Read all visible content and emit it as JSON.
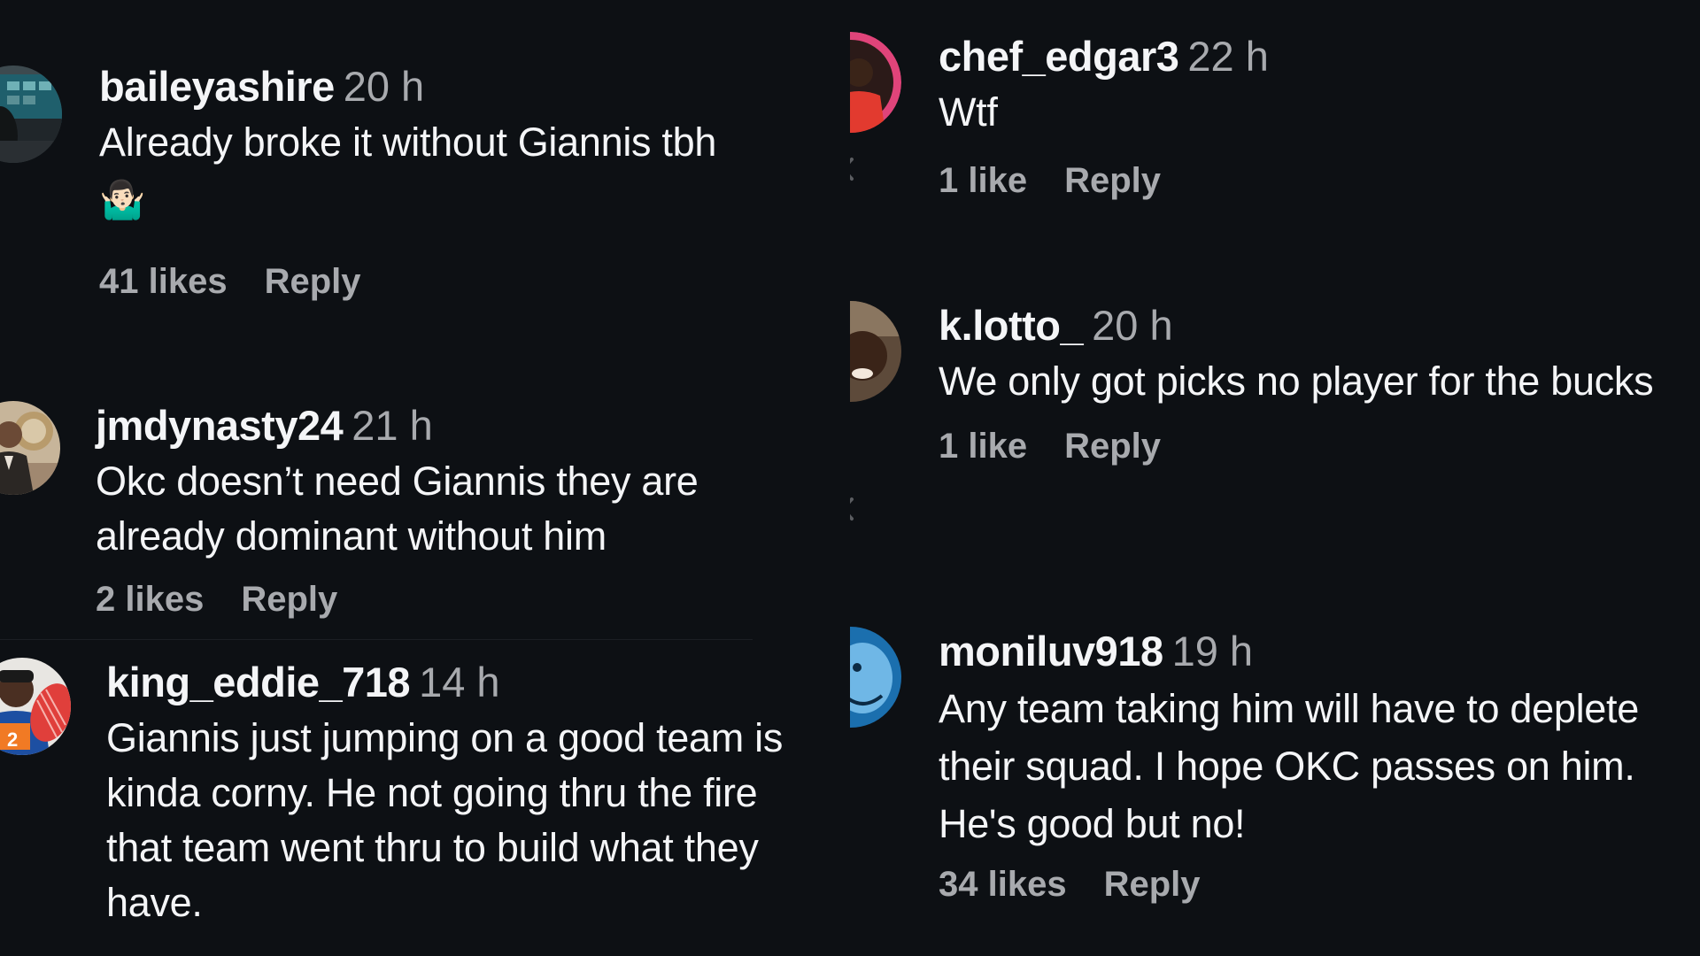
{
  "left_column": {
    "comments": [
      {
        "username": "baileyashire",
        "time": "20 h",
        "text": "Already broke it without Giannis tbh",
        "emoji": "🤷🏻‍♂️",
        "likes": "41 likes",
        "reply_label": "Reply"
      },
      {
        "username": "jmdynasty24",
        "time": "21 h",
        "text": "Okc doesn’t need Giannis they are already dominant without him",
        "likes": "2 likes",
        "reply_label": "Reply"
      },
      {
        "username": "king_eddie_718",
        "time": "14 h",
        "text": "Giannis just jumping on a good team is kinda corny. He not going thru the fire that team went thru to build what they have."
      }
    ]
  },
  "right_column": {
    "comments": [
      {
        "username": "chef_edgar3",
        "time": "22 h",
        "text": "Wtf",
        "likes": "1 like",
        "reply_label": "Reply"
      },
      {
        "username": "k.lotto_",
        "time": "20 h",
        "text": "We only got picks no player for the bucks",
        "likes": "1 like",
        "reply_label": "Reply"
      },
      {
        "username": "moniluv918",
        "time": "19 h",
        "text": "Any team taking him will have to deplete their squad. I hope OKC passes on him. He's good but no!",
        "likes": "34 likes",
        "reply_label": "Reply"
      }
    ]
  },
  "icons": {
    "reply_arrow": "reply-arrow-icon",
    "avatar": "user-avatar"
  },
  "colors": {
    "background": "#0d1014",
    "username": "#f4f5f7",
    "meta": "#a8aaae"
  }
}
